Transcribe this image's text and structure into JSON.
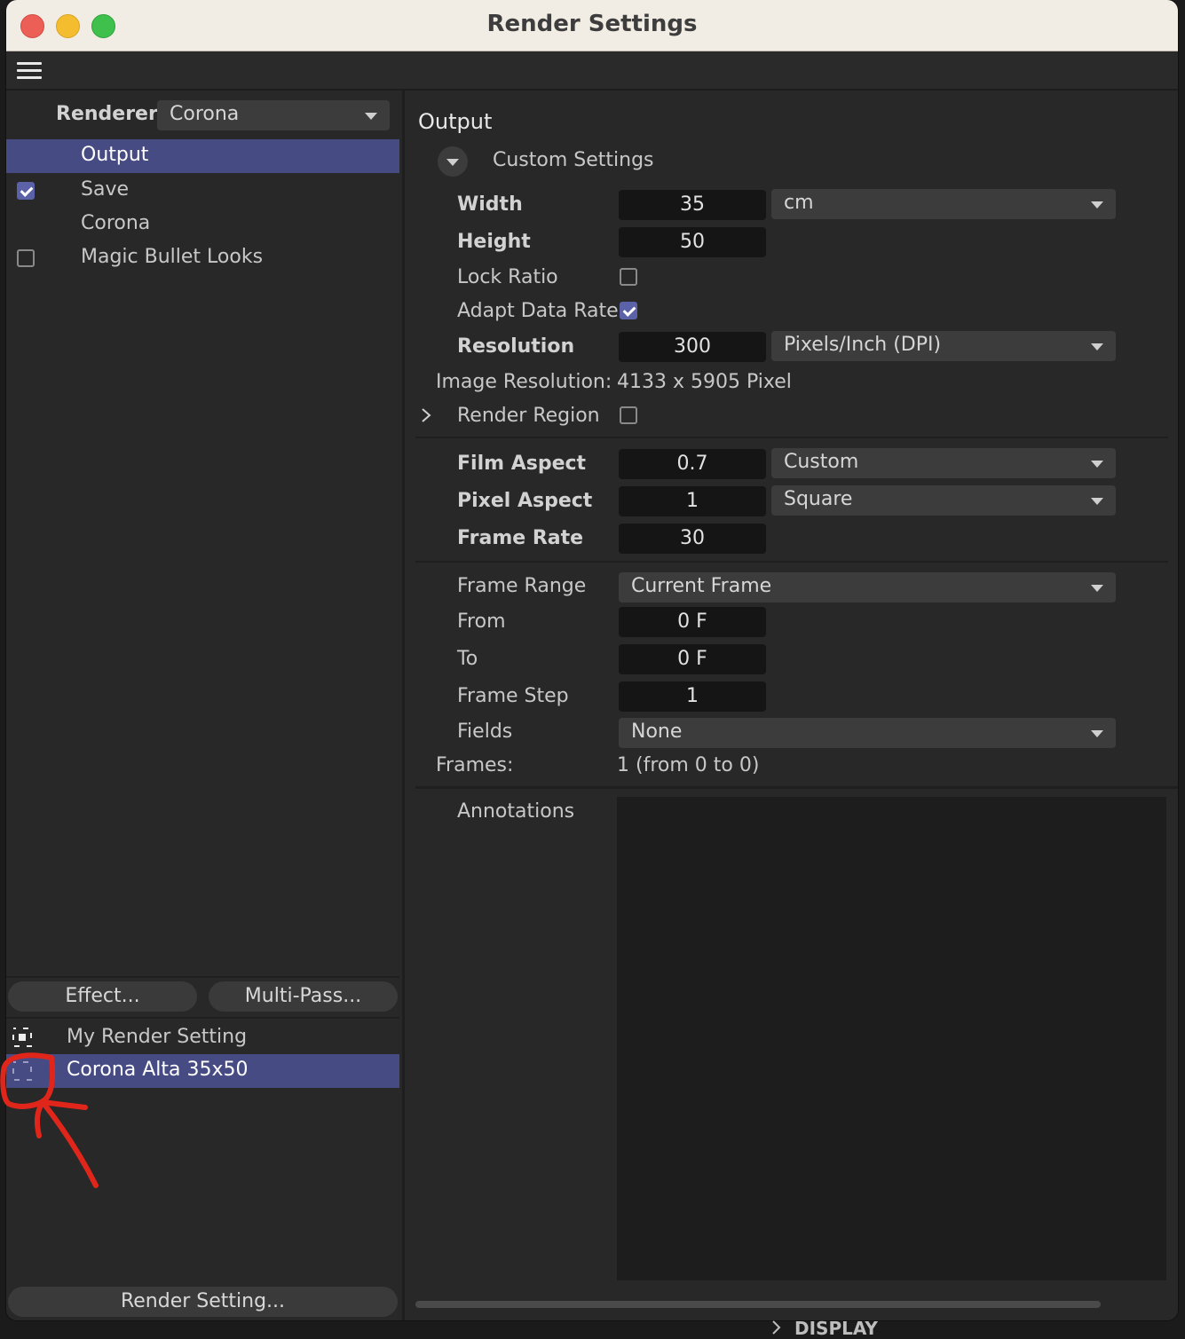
{
  "window": {
    "title": "Render Settings"
  },
  "renderer": {
    "label": "Renderer",
    "value": "Corona"
  },
  "sidebar": {
    "items": [
      {
        "label": "Output",
        "checkbox": "none",
        "selected": true
      },
      {
        "label": "Save",
        "checkbox": "checked",
        "selected": false
      },
      {
        "label": "Corona",
        "checkbox": "none",
        "selected": false
      },
      {
        "label": "Magic Bullet Looks",
        "checkbox": "unchecked",
        "selected": false
      }
    ],
    "effect_button": "Effect...",
    "multipass_button": "Multi-Pass...",
    "render_settings": [
      {
        "label": "My Render Setting",
        "selected": false
      },
      {
        "label": "Corona Alta 35x50",
        "selected": true
      }
    ],
    "render_setting_button": "Render Setting..."
  },
  "output": {
    "heading": "Output",
    "preset": "Custom Settings",
    "width": {
      "label": "Width",
      "value": "35",
      "unit": "cm"
    },
    "height": {
      "label": "Height",
      "value": "50"
    },
    "lock_ratio": {
      "label": "Lock Ratio",
      "checked": false
    },
    "adapt_data_rate": {
      "label": "Adapt Data Rate",
      "checked": true
    },
    "resolution": {
      "label": "Resolution",
      "value": "300",
      "unit": "Pixels/Inch (DPI)"
    },
    "image_resolution": {
      "label": "Image Resolution:",
      "value": "4133 x 5905 Pixel"
    },
    "render_region": {
      "label": "Render Region",
      "checked": false
    },
    "film_aspect": {
      "label": "Film Aspect",
      "value": "0.7",
      "preset": "Custom"
    },
    "pixel_aspect": {
      "label": "Pixel Aspect",
      "value": "1",
      "preset": "Square"
    },
    "frame_rate": {
      "label": "Frame Rate",
      "value": "30"
    },
    "frame_range": {
      "label": "Frame Range",
      "value": "Current Frame"
    },
    "from": {
      "label": "From",
      "value": "0 F"
    },
    "to": {
      "label": "To",
      "value": "0 F"
    },
    "frame_step": {
      "label": "Frame Step",
      "value": "1"
    },
    "fields": {
      "label": "Fields",
      "value": "None"
    },
    "frames": {
      "label": "Frames:",
      "value": "1 (from 0 to 0)"
    },
    "annotations": {
      "label": "Annotations",
      "value": ""
    }
  },
  "background_panel": {
    "label": "DISPLAY"
  },
  "colors": {
    "selection": "#474b84",
    "checkbox_on": "#5b62a8",
    "annotation_mark": "#e0261b"
  }
}
